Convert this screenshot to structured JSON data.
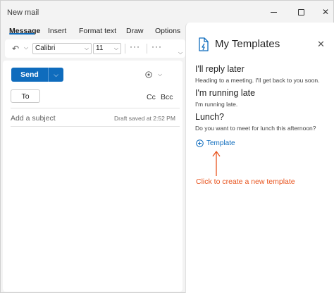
{
  "window": {
    "title": "New mail"
  },
  "tabs": [
    {
      "label": "Message"
    },
    {
      "label": "Insert"
    },
    {
      "label": "Format text"
    },
    {
      "label": "Draw"
    },
    {
      "label": "Options"
    }
  ],
  "toolbar": {
    "font": "Calibri",
    "size": "11",
    "more_label": "···"
  },
  "compose": {
    "send_label": "Send",
    "to_label": "To",
    "cc_label": "Cc",
    "bcc_label": "Bcc",
    "subject_placeholder": "Add a subject",
    "draft_status": "Draft saved at 2:52 PM"
  },
  "pane": {
    "title": "My Templates",
    "templates": [
      {
        "title": "I'll reply later",
        "body": "Heading to a meeting. I'll get back to you soon."
      },
      {
        "title": "I'm running late",
        "body": "I'm running late."
      },
      {
        "title": "Lunch?",
        "body": "Do you want to meet for lunch this afternoon?"
      }
    ],
    "add_label": "Template"
  },
  "annotation": {
    "text": "Click to create a new template"
  },
  "colors": {
    "accent": "#0f6cbd",
    "annotation": "#e8541e",
    "background": "#f3f3f3"
  }
}
